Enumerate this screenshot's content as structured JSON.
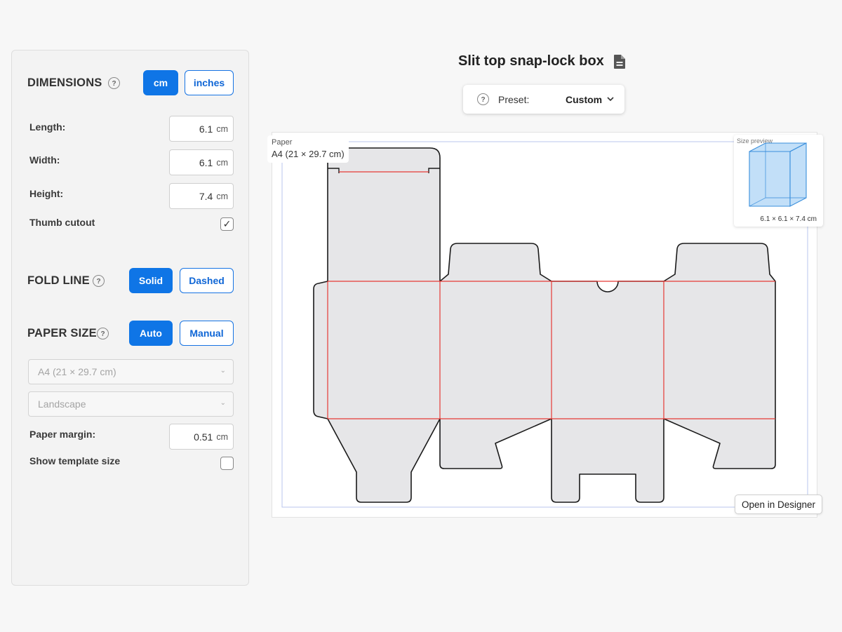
{
  "title": "Slit top snap-lock box",
  "preset": {
    "label": "Preset:",
    "value": "Custom"
  },
  "sidebar": {
    "dimensions": {
      "title": "DIMENSIONS",
      "unit_cm": "cm",
      "unit_inches": "inches",
      "active_unit": "cm",
      "length_label": "Length:",
      "length_value": "6.1",
      "width_label": "Width:",
      "width_value": "6.1",
      "height_label": "Height:",
      "height_value": "7.4",
      "unit_suffix": "cm",
      "thumb_label": "Thumb cutout",
      "thumb_checked": true
    },
    "fold_line": {
      "title": "FOLD LINE",
      "solid": "Solid",
      "dashed": "Dashed",
      "active": "Solid"
    },
    "paper_size": {
      "title": "PAPER SIZE",
      "auto": "Auto",
      "manual": "Manual",
      "active": "Auto",
      "paper_select": "A4 (21 × 29.7 cm)",
      "orientation_select": "Landscape",
      "margin_label": "Paper margin:",
      "margin_value": "0.51",
      "margin_unit": "cm",
      "show_size_label": "Show template size",
      "show_size_checked": false
    }
  },
  "canvas": {
    "paper_tag_title": "Paper",
    "paper_tag_value": "A4 (21 × 29.7 cm)",
    "size_preview_title": "Size preview",
    "size_preview_dims": "6.1 × 6.1 × 7.4 cm",
    "open_button": "Open in Designer"
  },
  "colors": {
    "accent": "#0f75e6",
    "cut_line": "#1a1a1a",
    "fold_line": "#e53935",
    "panel_fill": "#e6e6e8",
    "paper_border": "#b9c6ee",
    "preview_cube": "#8fc4f2"
  },
  "icons": [
    "help-icon",
    "document-icon",
    "chevron-down-icon",
    "checkmark-icon",
    "cube-icon"
  ]
}
